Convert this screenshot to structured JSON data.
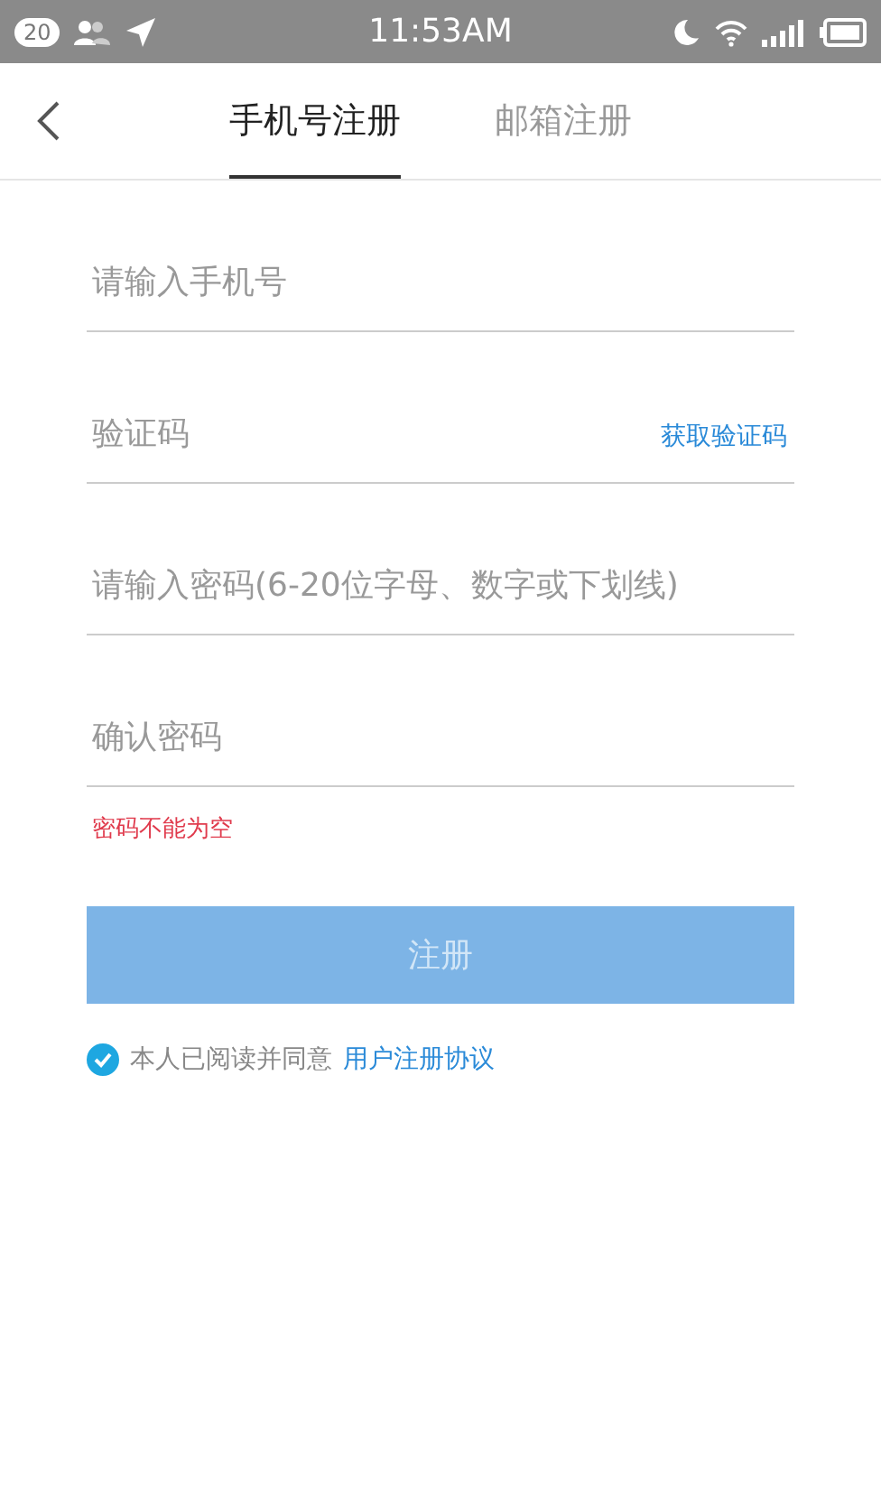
{
  "status_bar": {
    "notification_count": "20",
    "time": "11:53AM"
  },
  "tabs": [
    {
      "label": "手机号注册",
      "selected": true
    },
    {
      "label": "邮箱注册",
      "selected": false
    }
  ],
  "fields": [
    {
      "placeholder": "请输入手机号"
    },
    {
      "placeholder": "验证码",
      "action": "获取验证码"
    },
    {
      "placeholder": "请输入密码(6-20位字母、数字或下划线)"
    },
    {
      "placeholder": "确认密码"
    }
  ],
  "error": "密码不能为空",
  "submit": {
    "label": "注册",
    "disabled": true
  },
  "agreement": {
    "checked": true,
    "text": "本人已阅读并同意",
    "link": "用户注册协议"
  }
}
